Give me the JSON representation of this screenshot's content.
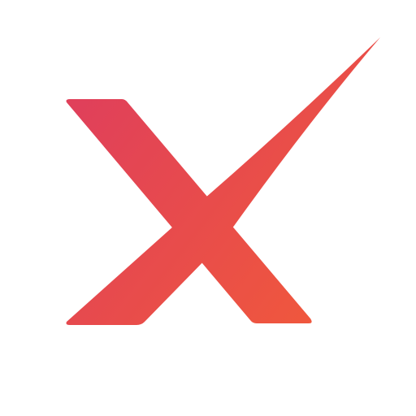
{
  "logo": {
    "icon": "x-mark-logo-icon",
    "colors": {
      "gradient_start": "#e0405a",
      "gradient_end": "#f0583c",
      "background": "#ffffff"
    }
  }
}
